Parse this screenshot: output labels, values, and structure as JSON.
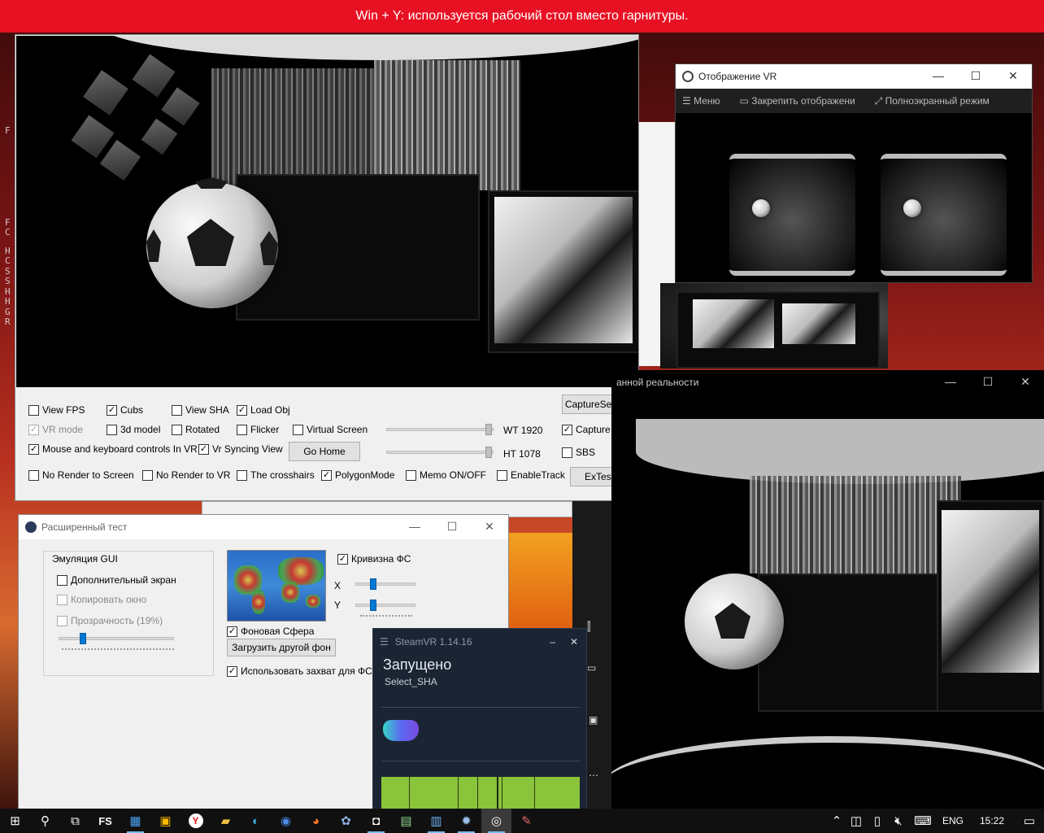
{
  "banner": {
    "text": "Win + Y: используется рабочий стол вместо гарнитуры."
  },
  "edge_letters": [
    "F",
    "",
    "",
    "",
    "",
    "",
    "",
    "",
    "",
    "",
    "F",
    "C",
    "",
    "H",
    "C",
    "S",
    "S",
    "H",
    "H",
    "G",
    "R"
  ],
  "main_window": {
    "capture_setup_label": "CaptureSetup",
    "go_home_label": "Go Home",
    "extest_label": "ExTest",
    "wt_label": "WT 1920",
    "ht_label": "HT 1078",
    "checkboxes": [
      {
        "label": "View FPS",
        "checked": false
      },
      {
        "label": "Cubs",
        "checked": true
      },
      {
        "label": "View SHA",
        "checked": false
      },
      {
        "label": "Load Obj",
        "checked": true
      },
      {
        "label": "VR mode",
        "checked": true,
        "disabled": true
      },
      {
        "label": "3d model",
        "checked": false
      },
      {
        "label": "Rotated",
        "checked": false
      },
      {
        "label": "Flicker",
        "checked": false
      },
      {
        "label": "Virtual Screen",
        "checked": false
      },
      {
        "label": "Capture",
        "checked": true
      },
      {
        "label": "Mouse and keyboard controls In VR",
        "checked": true
      },
      {
        "label": "Vr Syncing View",
        "checked": true
      },
      {
        "label": "SBS",
        "checked": false
      },
      {
        "label": "No Render to Screen",
        "checked": false
      },
      {
        "label": "No Render to VR",
        "checked": false
      },
      {
        "label": "The crosshairs",
        "checked": false
      },
      {
        "label": "PolygonMode",
        "checked": true
      },
      {
        "label": "Memo ON/OFF",
        "checked": false
      },
      {
        "label": "EnableTrack",
        "checked": false
      }
    ]
  },
  "vr_window": {
    "title": "Отображение VR",
    "toolbar": {
      "menu": "Меню",
      "pin": "Закрепить отображени",
      "fullscreen": "Полноэкранный режим"
    }
  },
  "mr_window": {
    "title": "анной реальности"
  },
  "win_controls": {
    "minimize": "—",
    "maximize": "☐",
    "close": "✕"
  },
  "ext_window": {
    "title": "Расширенный тест",
    "group_title": "Эмуляция GUI",
    "extra_screen": "Дополнительный экран",
    "copy_window": "Копировать окно",
    "transparency": "Прозрачность (19%)",
    "transparency_value": 19,
    "curvature_label": "Кривизна ФС",
    "x_label": "X",
    "y_label": "Y",
    "background_sphere": "Фоновая Сфера",
    "load_bg_button": "Загрузить другой фон",
    "use_capture": "Использовать захват для ФС"
  },
  "steamvr": {
    "title": "SteamVR 1.14.16",
    "status": "Запущено",
    "subtitle": "Select_SHA",
    "minimize": "–",
    "close": "✕"
  },
  "taskbar": {
    "lang": "ENG",
    "time": "15:22",
    "apps": [
      "start-icon",
      "search-icon",
      "taskview-icon",
      "fs-app-icon",
      "window-app-icon",
      "store-icon",
      "yandex-icon",
      "folder-icon",
      "edge-icon",
      "app-icon-1",
      "firefox-icon",
      "app-icon-2",
      "vr-app-icon",
      "terminal-icon",
      "window-app-icon-2",
      "steam-icon",
      "steamvr-icon",
      "paint-icon"
    ],
    "fs_label": "FS",
    "yandex_label": "Y"
  }
}
